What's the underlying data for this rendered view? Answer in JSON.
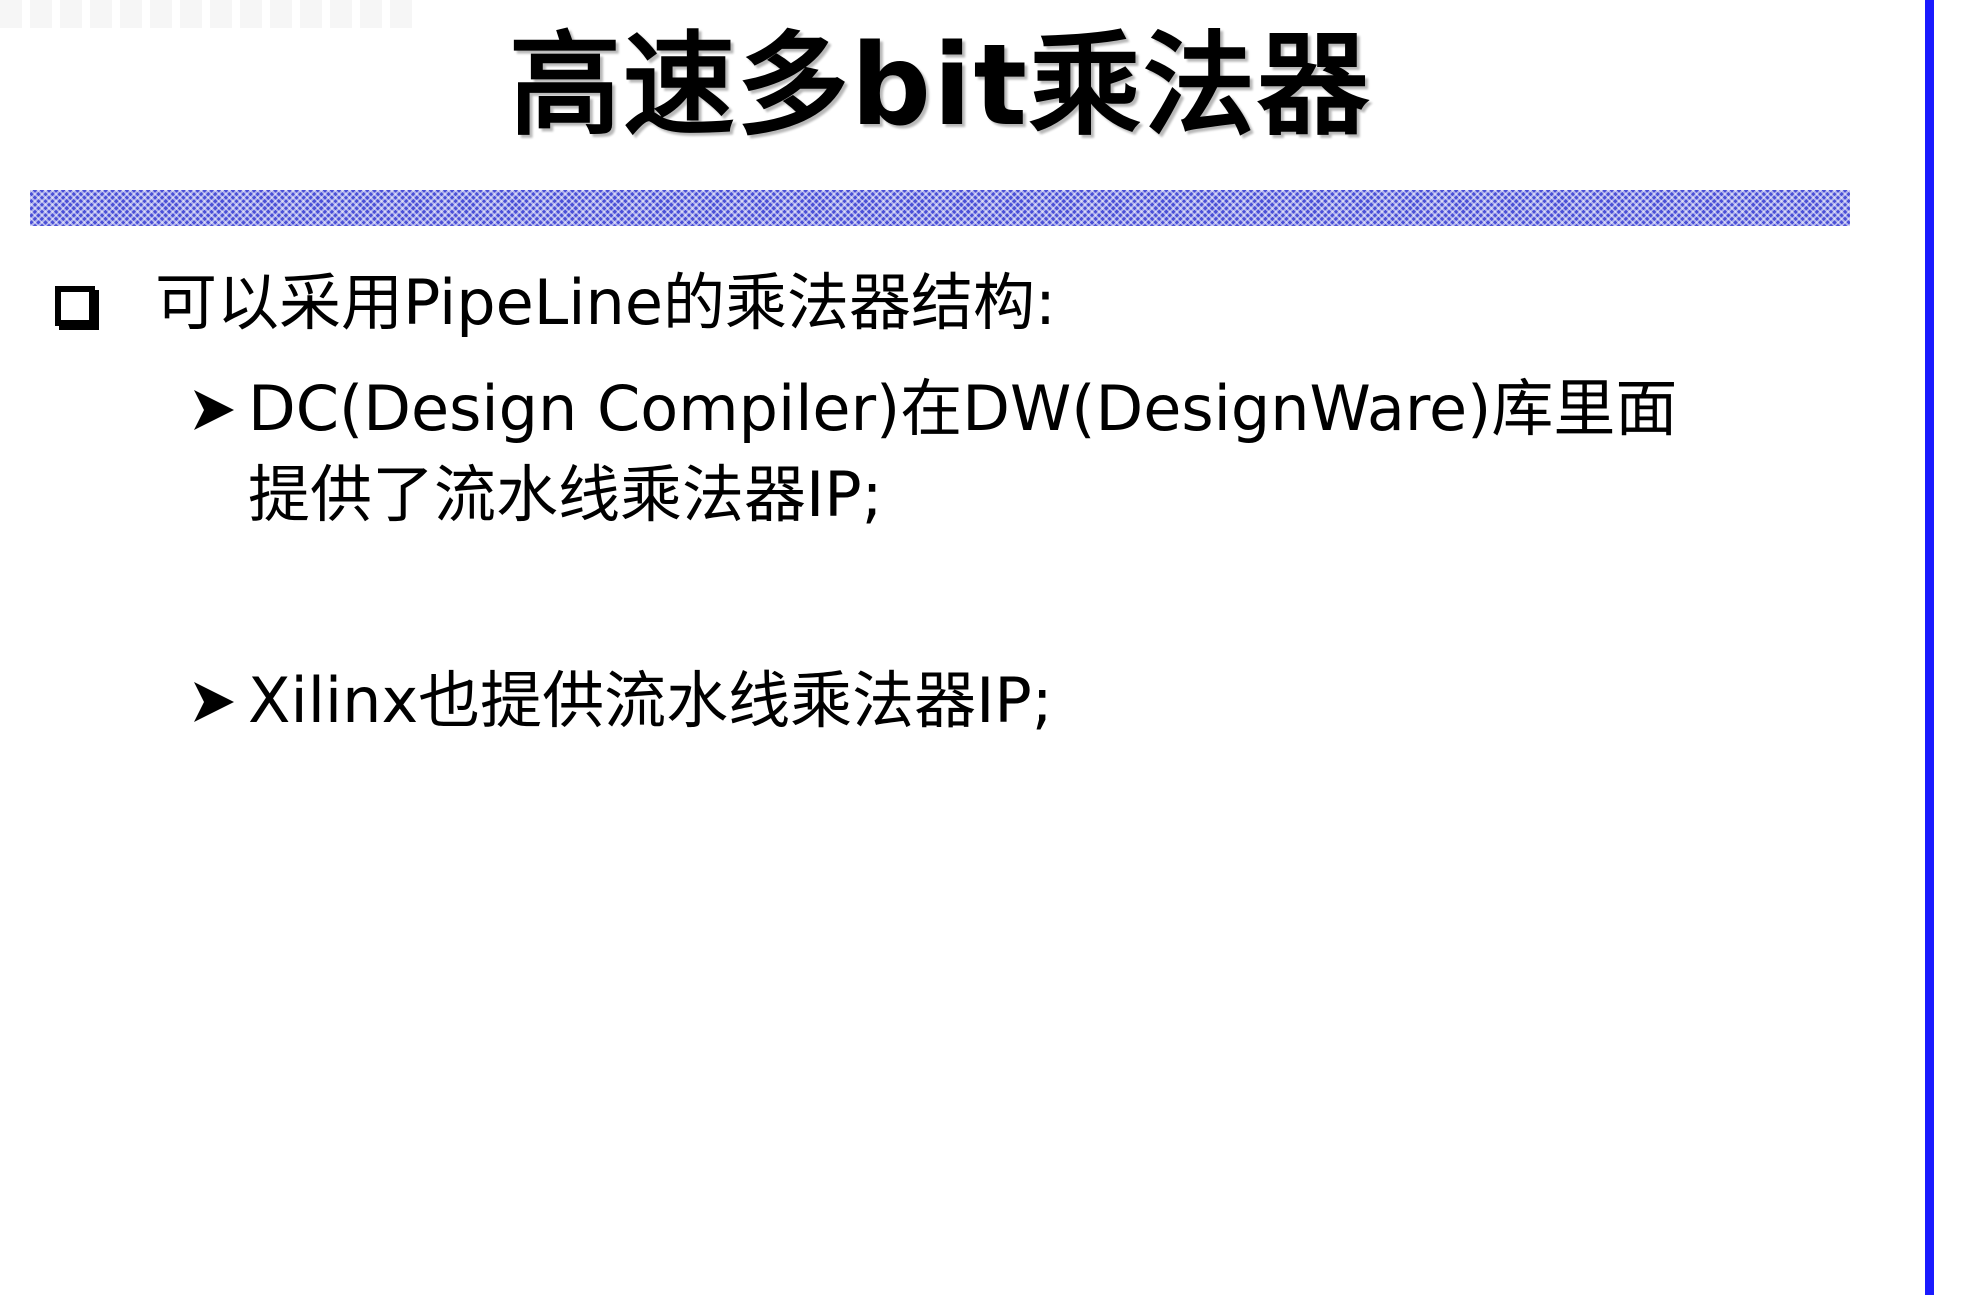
{
  "slide": {
    "title": "高速多bit乘法器",
    "bullet": {
      "text": "可以采用PipeLine的乘法器结构:",
      "sub_items": [
        {
          "line1": "DC(Design Compiler)在DW(DesignWare)库里面",
          "line2": "提供了流水线乘法器IP;"
        },
        {
          "line1": "Xilinx也提供流水线乘法器IP;"
        }
      ]
    }
  },
  "colors": {
    "border": "#1a1aff",
    "title_bar": "#4a4fd6",
    "text": "#000000",
    "background": "#ffffff"
  },
  "icons": {
    "bullet": "checkbox-icon",
    "sub_bullet": "arrow-right-icon"
  }
}
